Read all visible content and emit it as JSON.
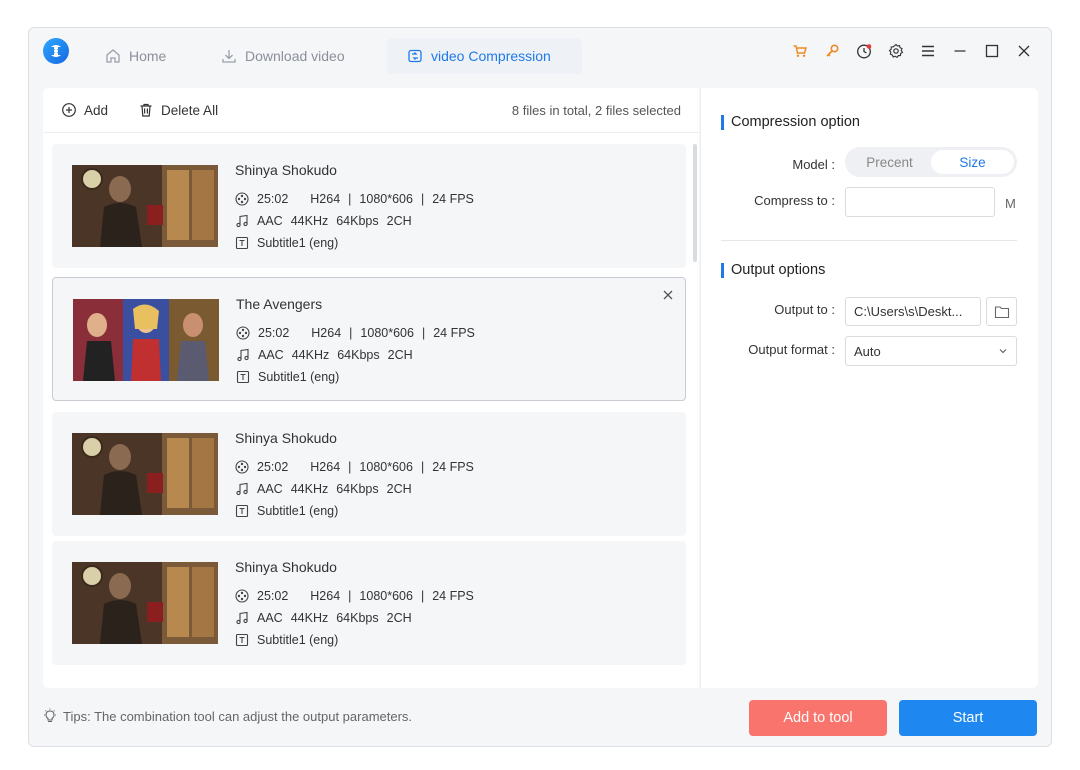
{
  "colors": {
    "accent": "#1f7ae8",
    "add_to_tool": "#f8746c",
    "start": "#1f88f0"
  },
  "tabs": [
    {
      "label": "Home",
      "icon": "home-icon"
    },
    {
      "label": "Download video",
      "icon": "download-icon"
    },
    {
      "label": "video Compression",
      "icon": "compress-icon",
      "active": true
    }
  ],
  "titlebar_icons": [
    "cart-icon",
    "key-icon",
    "clock-icon",
    "gear-icon",
    "menu-icon",
    "minimize-icon",
    "maximize-icon",
    "close-icon"
  ],
  "toolbar": {
    "add_label": "Add",
    "delete_all_label": "Delete All",
    "file_count": "8 files in total, 2 files selected"
  },
  "files": [
    {
      "title": "Shinya Shokudo",
      "duration": "25:02",
      "codec": "H264",
      "resolution": "1080*606",
      "fps": "24 FPS",
      "audio_codec": "AAC",
      "sample_rate": "44KHz",
      "bitrate": "64Kbps",
      "channels": "2CH",
      "subtitle": "Subtitle1 (eng)"
    },
    {
      "title": "The Avengers",
      "duration": "25:02",
      "codec": "H264",
      "resolution": "1080*606",
      "fps": "24 FPS",
      "audio_codec": "AAC",
      "sample_rate": "44KHz",
      "bitrate": "64Kbps",
      "channels": "2CH",
      "subtitle": "Subtitle1 (eng)",
      "selected": true
    },
    {
      "title": "Shinya Shokudo",
      "duration": "25:02",
      "codec": "H264",
      "resolution": "1080*606",
      "fps": "24 FPS",
      "audio_codec": "AAC",
      "sample_rate": "44KHz",
      "bitrate": "64Kbps",
      "channels": "2CH",
      "subtitle": "Subtitle1 (eng)"
    },
    {
      "title": "Shinya Shokudo",
      "duration": "25:02",
      "codec": "H264",
      "resolution": "1080*606",
      "fps": "24 FPS",
      "audio_codec": "AAC",
      "sample_rate": "44KHz",
      "bitrate": "64Kbps",
      "channels": "2CH",
      "subtitle": "Subtitle1 (eng)"
    }
  ],
  "compression": {
    "section_title": "Compression option",
    "model_label": "Model :",
    "model_options": [
      "Precent",
      "Size"
    ],
    "model_selected": "Size",
    "compress_label": "Compress to :",
    "compress_value": "",
    "compress_unit": "M"
  },
  "output": {
    "section_title": "Output options",
    "output_to_label": "Output to :",
    "output_path": "C:\\Users\\s\\Deskt...",
    "format_label": "Output format :",
    "format_value": "Auto"
  },
  "footer": {
    "tips": "Tips: The combination tool can adjust the output parameters.",
    "add_to_tool_label": "Add to tool",
    "start_label": "Start"
  }
}
